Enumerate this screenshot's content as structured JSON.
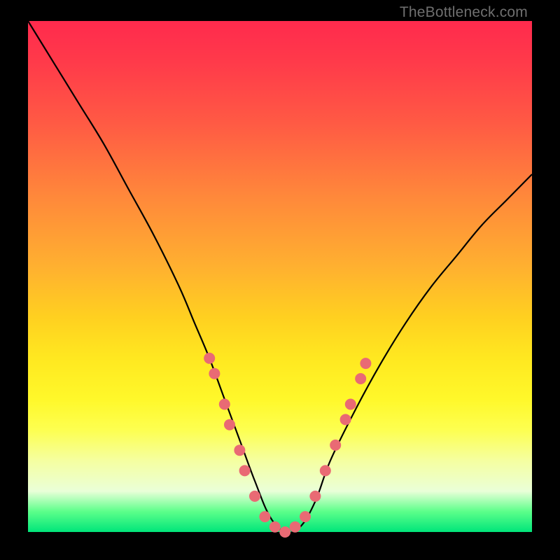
{
  "watermark": "TheBottleneck.com",
  "chart_data": {
    "type": "line",
    "title": "",
    "xlabel": "",
    "ylabel": "",
    "xlim": [
      0,
      100
    ],
    "ylim": [
      0,
      100
    ],
    "grid": false,
    "legend": null,
    "background_gradient": {
      "top_color": "#ff2a4d",
      "mid_color": "#ffe820",
      "bottom_color": "#00e57a"
    },
    "series": [
      {
        "name": "bottleneck-curve",
        "color": "#000000",
        "x": [
          0,
          5,
          10,
          15,
          20,
          25,
          30,
          33,
          36,
          39,
          42,
          45,
          48,
          51,
          54,
          57,
          60,
          65,
          70,
          75,
          80,
          85,
          90,
          95,
          100
        ],
        "y": [
          100,
          92,
          84,
          76,
          67,
          58,
          48,
          41,
          34,
          26,
          18,
          10,
          3,
          0,
          1,
          6,
          14,
          24,
          33,
          41,
          48,
          54,
          60,
          65,
          70
        ]
      }
    ],
    "markers": {
      "name": "highlight-points",
      "color": "#e96a74",
      "radius_px": 8,
      "points": [
        {
          "x": 36,
          "y": 34
        },
        {
          "x": 37,
          "y": 31
        },
        {
          "x": 39,
          "y": 25
        },
        {
          "x": 40,
          "y": 21
        },
        {
          "x": 42,
          "y": 16
        },
        {
          "x": 43,
          "y": 12
        },
        {
          "x": 45,
          "y": 7
        },
        {
          "x": 47,
          "y": 3
        },
        {
          "x": 49,
          "y": 1
        },
        {
          "x": 51,
          "y": 0
        },
        {
          "x": 53,
          "y": 1
        },
        {
          "x": 55,
          "y": 3
        },
        {
          "x": 57,
          "y": 7
        },
        {
          "x": 59,
          "y": 12
        },
        {
          "x": 61,
          "y": 17
        },
        {
          "x": 63,
          "y": 22
        },
        {
          "x": 64,
          "y": 25
        },
        {
          "x": 66,
          "y": 30
        },
        {
          "x": 67,
          "y": 33
        }
      ]
    }
  }
}
